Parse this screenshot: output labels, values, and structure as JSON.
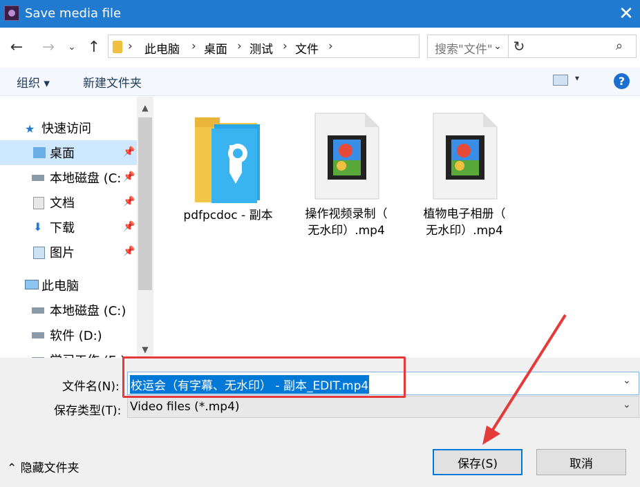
{
  "window": {
    "title": "Save media file",
    "close_glyph": "✕"
  },
  "nav": {
    "back_icon": "left-arrow-icon",
    "forward_icon": "right-arrow-icon",
    "recent_icon": "chevron-down-icon",
    "up_icon": "up-arrow-icon",
    "breadcrumb": [
      "此电脑",
      "桌面",
      "测试",
      "文件"
    ],
    "search_placeholder": "搜索\"文件\""
  },
  "toolbar": {
    "organize_label": "组织 ▾",
    "new_folder_label": "新建文件夹",
    "help_glyph": "?"
  },
  "sidebar": {
    "items": [
      {
        "label": "快速访问",
        "icon": "star-icon"
      },
      {
        "label": "桌面",
        "icon": "desktop-folder-icon",
        "pinned": true,
        "selected": true
      },
      {
        "label": "本地磁盘 (C:",
        "icon": "drive-icon",
        "pinned": true
      },
      {
        "label": "文档",
        "icon": "documents-icon",
        "pinned": true
      },
      {
        "label": "下载",
        "icon": "downloads-icon",
        "pinned": true
      },
      {
        "label": "图片",
        "icon": "pictures-icon",
        "pinned": true
      },
      {
        "label": "此电脑",
        "icon": "computer-icon"
      },
      {
        "label": "本地磁盘 (C:)",
        "icon": "drive-icon"
      },
      {
        "label": "软件 (D:)",
        "icon": "drive-icon"
      },
      {
        "label": "学习工作 (E:)",
        "icon": "drive-icon"
      }
    ]
  },
  "files": [
    {
      "line1": "pdfpcdoc - 副本",
      "line2": "",
      "icon": "folder-icon"
    },
    {
      "line1": "操作视频录制（",
      "line2": "无水印）.mp4",
      "icon": "video-file-icon"
    },
    {
      "line1": "植物电子相册（",
      "line2": "无水印）.mp4",
      "icon": "video-file-icon"
    }
  ],
  "form": {
    "filename_label": "文件名(N):",
    "filename_value": "校运会（有字幕、无水印） - 副本_EDIT.mp4",
    "filetype_label": "保存类型(T):",
    "filetype_value": "Video files (*.mp4)"
  },
  "footer": {
    "hide_folders_label": "隐藏文件夹",
    "save_label": "保存(S)",
    "cancel_label": "取消"
  },
  "colors": {
    "titlebar": "#1f7ad0",
    "selection": "#0078d7",
    "annotation": "#e53a3a"
  }
}
